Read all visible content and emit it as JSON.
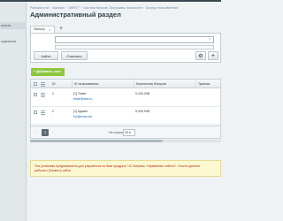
{
  "sidebar": {
    "items": [
      {
        "label": "ьности"
      },
      {
        "label": "окупатели"
      }
    ]
  },
  "breadcrumb": [
    "Рабочий стол",
    "Магазин",
    "\"АКРИТ\"",
    "Система бонусов. Программы лояльности",
    "Бонусы пользователей"
  ],
  "page": {
    "title": "Административный раздел"
  },
  "filter": {
    "tab_label": "Фильтр",
    "find_label": "Найти",
    "cancel_label": "Отменить"
  },
  "toolbar": {
    "add_label": "Добавить счет"
  },
  "table": {
    "columns": [
      "ID",
      "ID пользователя",
      "Количество бонусов",
      "Транзак"
    ],
    "rows": [
      {
        "id": "1",
        "user": "[1] Tester",
        "email": "tester@test.ru",
        "bonus": "5,100.00$"
      },
      {
        "id": "2",
        "user": "[1] Админ",
        "email": "foo@mine.me",
        "bonus": "5,000.00$"
      }
    ]
  },
  "pager": {
    "current": "1",
    "per_page_label": "На странице:",
    "per_page_value": "20"
  },
  "notice": {
    "line1": "Эта установка предназначена для разработки на базе продукта \"1С-Битрикс: Управление сайтом\". Она не должна",
    "line2": "рабочего (боевого) сайта"
  }
}
